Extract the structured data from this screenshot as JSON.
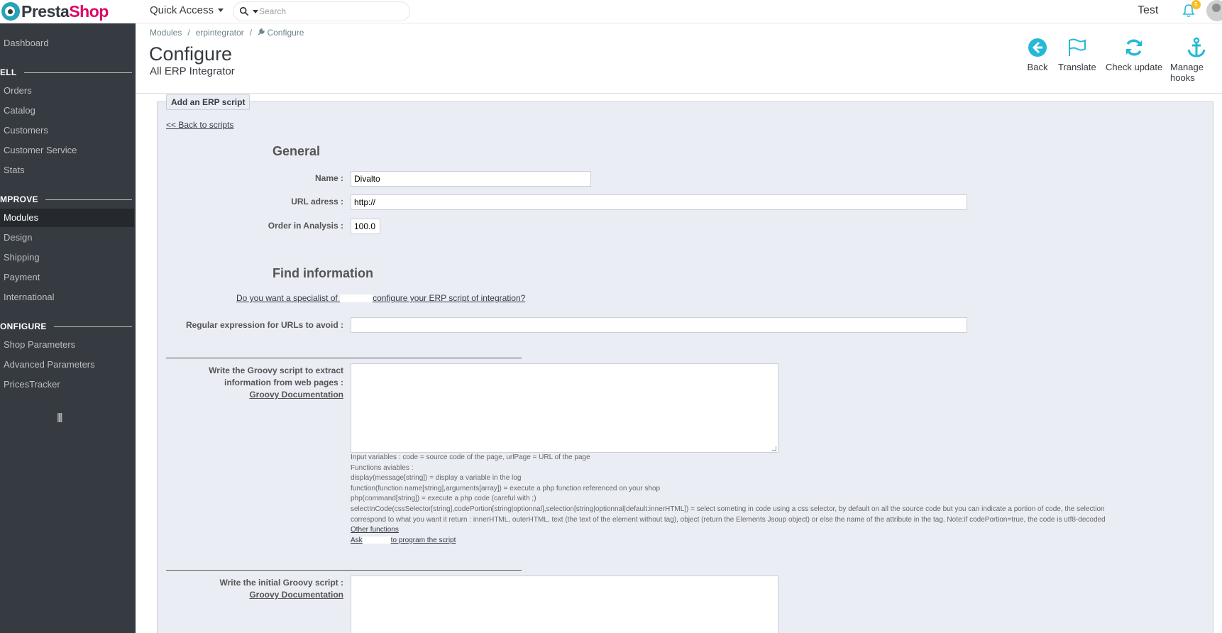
{
  "brand": {
    "name_part1": "Presta",
    "name_part2": "Shop"
  },
  "header": {
    "quick_access": "Quick Access",
    "search_placeholder": "Search",
    "shop_name": "Test",
    "notifications_count": "5"
  },
  "sidebar": {
    "dashboard": "Dashboard",
    "sections": {
      "sell": "ELL",
      "improve": "MPROVE",
      "configure": "ONFIGURE"
    },
    "sell_items": [
      "Orders",
      "Catalog",
      "Customers",
      "Customer Service",
      "Stats"
    ],
    "improve_items": [
      "Modules",
      "Design",
      "Shipping",
      "Payment",
      "International"
    ],
    "configure_items": [
      "Shop Parameters",
      "Advanced Parameters",
      "PricesTracker"
    ],
    "active_item": "Modules"
  },
  "breadcrumb": {
    "item1": "Modules",
    "item2": "erpintegrator",
    "item3": "Configure"
  },
  "page": {
    "title": "Configure",
    "subtitle": "All ERP Integrator"
  },
  "toolbar": {
    "back": "Back",
    "translate": "Translate",
    "check_update": "Check update",
    "manage_hooks": "Manage hooks"
  },
  "panel": {
    "legend": "Add an ERP script",
    "back_link": "<< Back to scripts",
    "general_title": "General",
    "name_label": "Name :",
    "name_value": "Divalto",
    "url_label": "URL adress :",
    "url_value": "http://",
    "order_label": "Order in Analysis :",
    "order_value": "100.0",
    "find_title": "Find information",
    "specialist_part1": "Do you want a specialist of ",
    "specialist_part2": "configure your ERP script of integration?",
    "regex_label": "Regular expression for URLs to avoid :",
    "regex_value": "",
    "groovy_label_1": "Write the Groovy script to extract",
    "groovy_label_2": "information from web pages :",
    "groovy_doc_link": "Groovy Documentation",
    "help_lines": [
      "Input variables : code = source code of the page, urlPage = URL of the page",
      "Functions aviables :",
      "display(message[string]) = display a variable in the log",
      "function(function name[string],arguments[array]) = execute a php function referenced on your shop",
      "php(command[string]) = execute a php code (careful with ;)",
      "selectInCode(cssSelector[string],codePortion[string|optionnal],selection[string|optionnal|default:innerHTML]) = select someting in code using a css selector, by default on all the source code but you can indicate a portion of code, the selection",
      "correspond to what you want it return : innerHTML, outerHTML, text (the text of the element without tag), object (return the Elements Jsoup object) or else the name of the attribute in the tag. Note:if codePortion=true, the code is utf8-decoded"
    ],
    "other_functions": "Other functions",
    "ask_part1": "Ask",
    "ask_part2": "to program the script",
    "initial_label": "Write the initial Groovy script :",
    "initial_doc_link": "Groovy Documentation"
  },
  "colors": {
    "sidebar_bg": "#363a41",
    "sidebar_active_bg": "#25282d",
    "accent": "#25b9d7",
    "brand_pink": "#df0067",
    "panel_bg": "#ebedf4",
    "badge": "#fbbb22"
  }
}
